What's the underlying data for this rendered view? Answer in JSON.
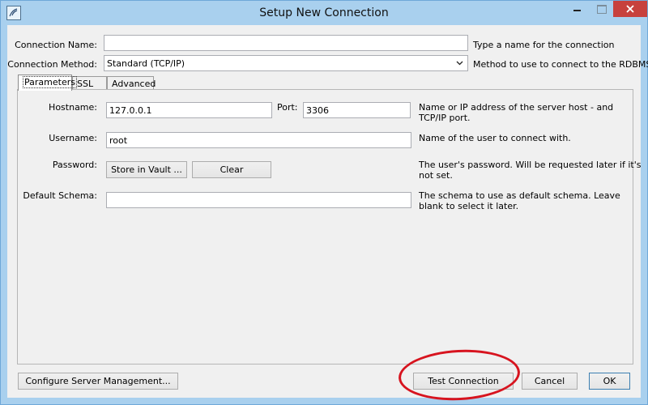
{
  "window": {
    "title": "Setup New Connection"
  },
  "form": {
    "connection_name_label": "Connection Name:",
    "connection_name_value": "",
    "connection_name_hint": "Type a name for the connection",
    "connection_method_label": "Connection Method:",
    "connection_method_value": "Standard (TCP/IP)",
    "connection_method_hint": "Method to use to connect to the RDBMS"
  },
  "tabs": [
    {
      "label": "Parameters",
      "active": true
    },
    {
      "label": "SSL",
      "active": false
    },
    {
      "label": "Advanced",
      "active": false
    }
  ],
  "parameters": {
    "hostname_label": "Hostname:",
    "hostname_value": "127.0.0.1",
    "port_label": "Port:",
    "port_value": "3306",
    "host_hint_line1": "Name or IP address of the server host - and",
    "host_hint_line2": "TCP/IP port.",
    "username_label": "Username:",
    "username_value": "root",
    "username_hint": "Name of the user to connect with.",
    "password_label": "Password:",
    "store_in_vault": "Store in Vault ...",
    "clear": "Clear",
    "password_hint_line1": "The user's password. Will be requested later if it's",
    "password_hint_line2": "not set.",
    "default_schema_label": "Default Schema:",
    "default_schema_value": "",
    "schema_hint_line1": "The schema to use as default schema. Leave",
    "schema_hint_line2": "blank to select it later."
  },
  "footer": {
    "configure": "Configure Server Management...",
    "test": "Test Connection",
    "cancel": "Cancel",
    "ok": "OK"
  },
  "colors": {
    "titlebar": "#a9d0ee",
    "close": "#c7413d",
    "annotation": "#d7141f",
    "dialog": "#f0f0f0"
  },
  "icons": {
    "app": "workbench-dolphin-icon",
    "minimize": "minimize-icon",
    "maximize": "maximize-icon",
    "close": "close-icon",
    "dropdown": "chevron-down-icon"
  }
}
